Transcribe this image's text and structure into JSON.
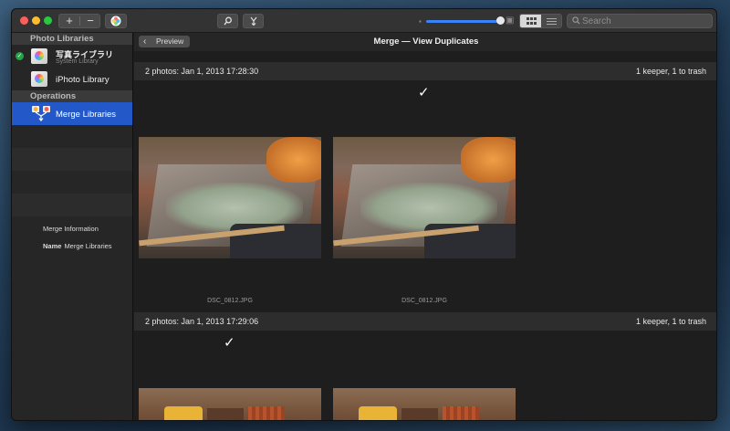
{
  "toolbar": {
    "add_label": "+",
    "remove_label": "−",
    "search_placeholder": "Search"
  },
  "sidebar": {
    "libraries_header": "Photo Libraries",
    "libraries": [
      {
        "title": "写真ライブラリ",
        "subtitle": "System Library"
      },
      {
        "title": "iPhoto Library"
      }
    ],
    "operations_header": "Operations",
    "operations": [
      {
        "title": "Merge Libraries"
      }
    ],
    "info": {
      "header": "Merge Information",
      "name_key": "Name",
      "name_value": "Merge Libraries"
    }
  },
  "main": {
    "back_label": "Preview",
    "title": "Merge — View Duplicates",
    "groups": [
      {
        "title": "2 photos: Jan 1, 2013 17:28:30",
        "status": "1 keeper, 1 to trash",
        "check": "✓",
        "photos": [
          {
            "filename": "DSC_0812.JPG"
          },
          {
            "filename": "DSC_0812.JPG"
          }
        ]
      },
      {
        "title": "2 photos: Jan 1, 2013 17:29:06",
        "status": "1 keeper, 1 to trash",
        "check": "✓"
      }
    ]
  },
  "colors": {
    "selection": "#2258c8",
    "slider": "#3b82f6",
    "check_badge": "#22a447"
  }
}
